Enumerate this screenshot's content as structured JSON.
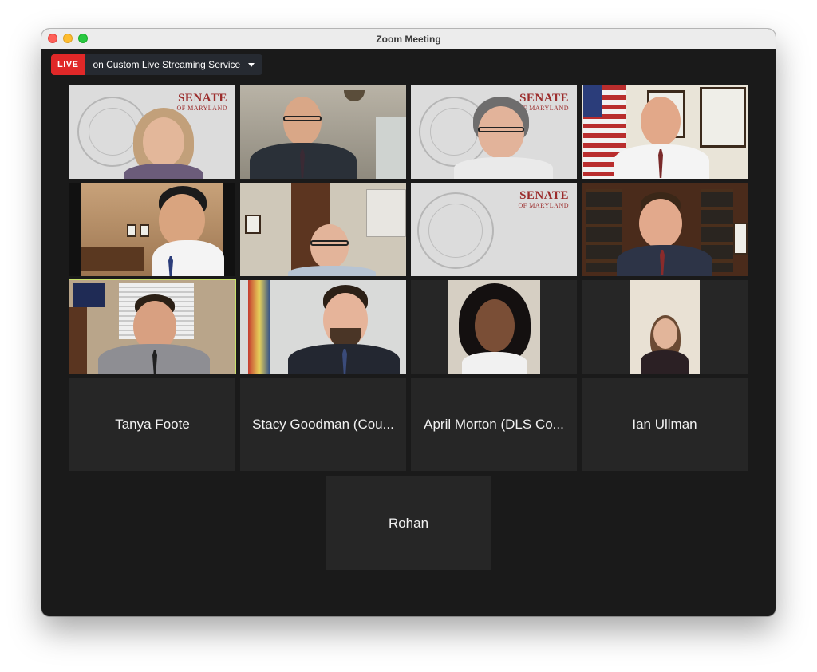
{
  "window": {
    "title": "Zoom Meeting"
  },
  "live": {
    "badge": "LIVE",
    "text": "on Custom Live Streaming Service"
  },
  "seal": {
    "word": "SENATE",
    "sub": "OF MARYLAND"
  },
  "participants_no_video": [
    {
      "name": "Tanya Foote"
    },
    {
      "name": "Stacy Goodman (Cou..."
    },
    {
      "name": "April Morton (DLS Co..."
    },
    {
      "name": "Ian Ullman"
    },
    {
      "name": "Rohan"
    }
  ],
  "colors": {
    "window_bg": "#1a1a1a",
    "tile_bg": "#262626",
    "live_red": "#e02828",
    "active_speaker": "#c8e06a",
    "senate_red": "#9b2c2c"
  }
}
